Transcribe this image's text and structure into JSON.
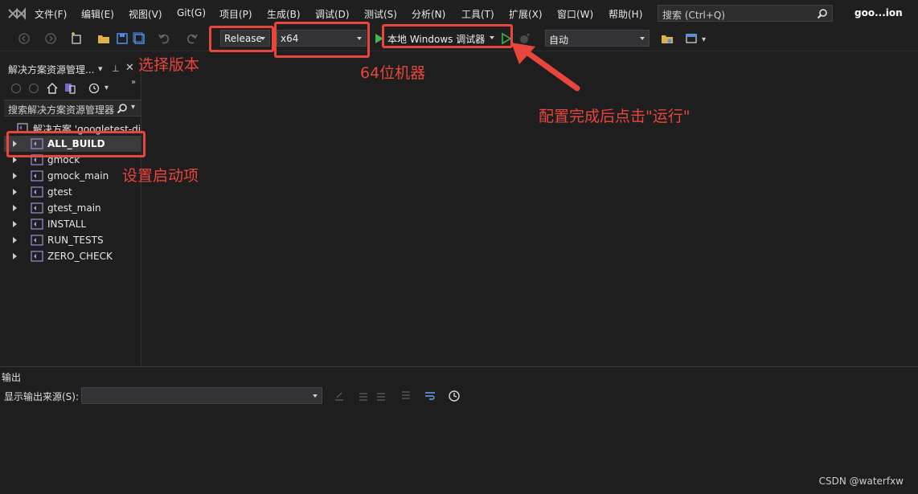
{
  "menubar": {
    "items": [
      "文件(F)",
      "编辑(E)",
      "视图(V)",
      "Git(G)",
      "项目(P)",
      "生成(B)",
      "调试(D)",
      "测试(S)",
      "分析(N)",
      "工具(T)",
      "扩展(X)",
      "窗口(W)",
      "帮助(H)"
    ],
    "search_placeholder": "搜索 (Ctrl+Q)",
    "solution_name": "goo...ion"
  },
  "toolbar": {
    "configuration": "Release",
    "platform": "x64",
    "debugger": "本地 Windows 调试器",
    "mode": "自动"
  },
  "solution_explorer": {
    "title": "解决方案资源管理...",
    "search_placeholder": "搜索解决方案资源管理器",
    "solution_label": "解决方案 'googletest-di",
    "projects": [
      "ALL_BUILD",
      "gmock",
      "gmock_main",
      "gtest",
      "gtest_main",
      "INSTALL",
      "RUN_TESTS",
      "ZERO_CHECK"
    ],
    "selected": "ALL_BUILD"
  },
  "output": {
    "title": "输出",
    "source_label": "显示输出来源(S):"
  },
  "annotations": {
    "select_version": "选择版本",
    "machine_64": "64位机器",
    "run_hint": "配置完成后点击\"运行\"",
    "startup_item": "设置启动项"
  },
  "watermark": "CSDN @waterfxw",
  "colors": {
    "annotation_red": "#e8453c",
    "run_green": "#3fb950",
    "background": "#1e1e1e"
  }
}
